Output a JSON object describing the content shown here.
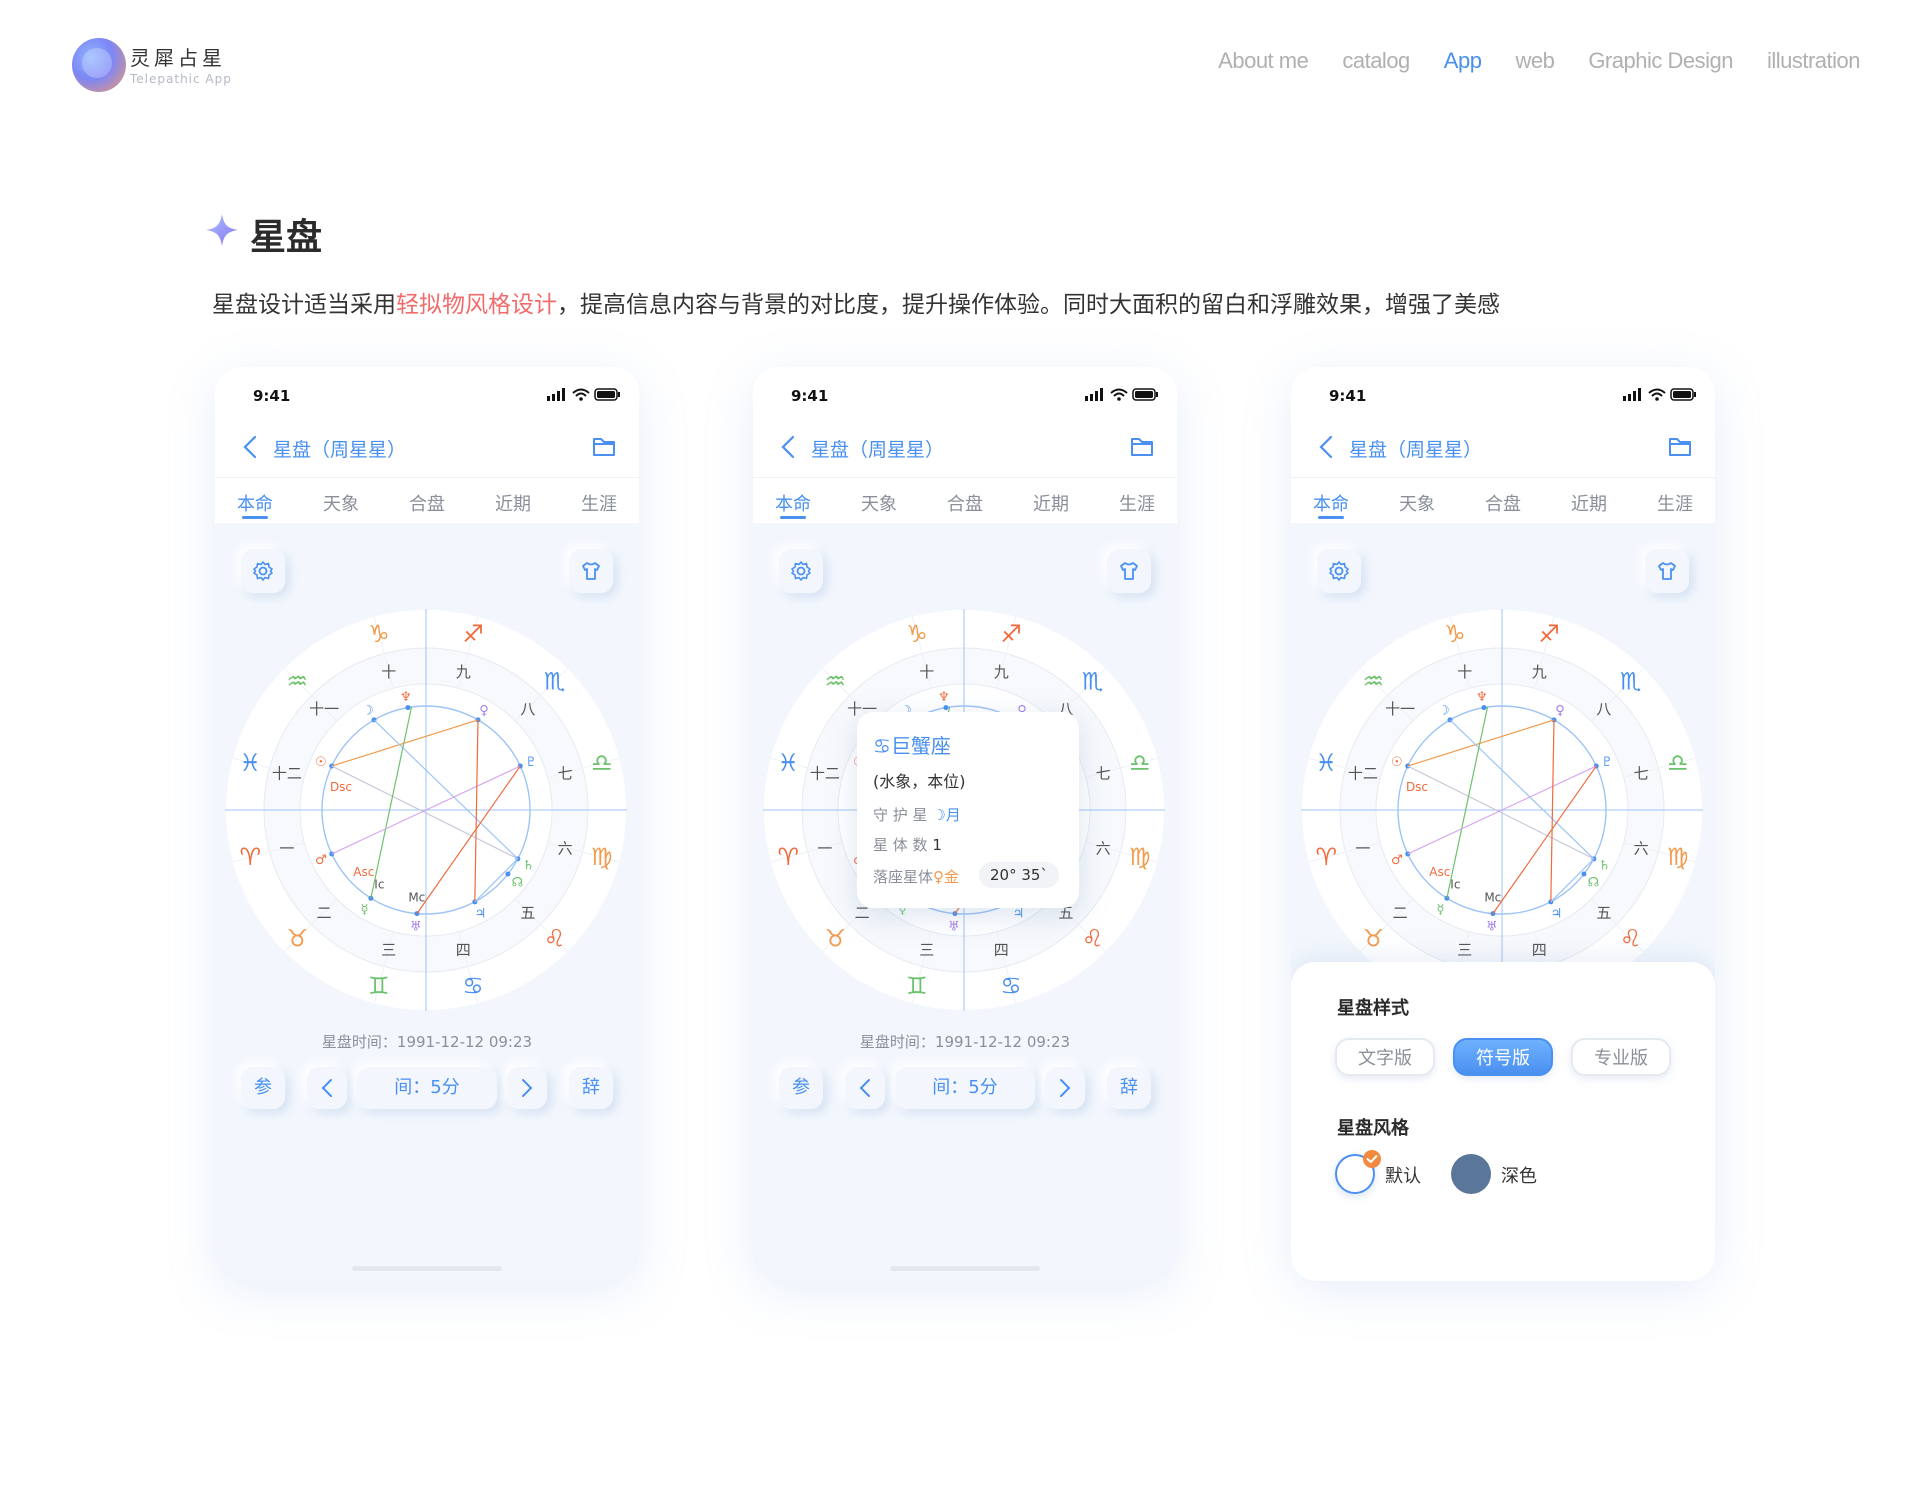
{
  "brand": {
    "title": "灵犀占星",
    "subtitle": "Telepathic App"
  },
  "nav": [
    "About me",
    "catalog",
    "App",
    "web",
    "Graphic Design",
    "illustration"
  ],
  "nav_active": "App",
  "section": {
    "title": "星盘",
    "desc_before": "星盘设计适当采用",
    "desc_highlight": "轻拟物风格设计",
    "desc_after": "，提高信息内容与背景的对比度，提升操作体验。同时大面积的留白和浮雕效果，增强了美感"
  },
  "phone": {
    "time": "9:41",
    "title": "星盘（周星星）",
    "tabs": [
      "本命",
      "天象",
      "合盘",
      "近期",
      "生涯"
    ],
    "active_tab": "本命",
    "chart_time": "星盘时间：1991-12-12 09:23",
    "controls": {
      "left": "参",
      "interval": "间：5分",
      "right": "辞"
    },
    "houses": [
      "一",
      "二",
      "三",
      "四",
      "五",
      "六",
      "七",
      "八",
      "九",
      "十",
      "十一",
      "十二"
    ],
    "angles": {
      "asc": "Asc",
      "dsc": "Dsc",
      "mc": "Mc",
      "ic": "Ic"
    }
  },
  "tooltip": {
    "title": "巨蟹座",
    "sub": "(水象，本位)",
    "ruler_label": "守 护 星",
    "ruler_value": "☽月",
    "count_label": "星 体 数",
    "count_value": "1",
    "planet_label": "落座星体",
    "planet_value": "♀金",
    "degree": "20° 35`"
  },
  "sheet": {
    "style_label": "星盘样式",
    "options": [
      "文字版",
      "符号版",
      "专业版"
    ],
    "selected": "符号版",
    "theme_label": "星盘风格",
    "themes": [
      {
        "name": "默认",
        "color": "#ffffff"
      },
      {
        "name": "深色",
        "color": "#5a7699"
      }
    ],
    "selected_theme": "默认"
  },
  "colors": {
    "accent": "#4a90f0",
    "highlight": "#f26b6b",
    "fire": "#f06a3c",
    "earth": "#f29b4d",
    "air": "#6cc26c",
    "water": "#4a90f0",
    "check": "#f2893e"
  }
}
